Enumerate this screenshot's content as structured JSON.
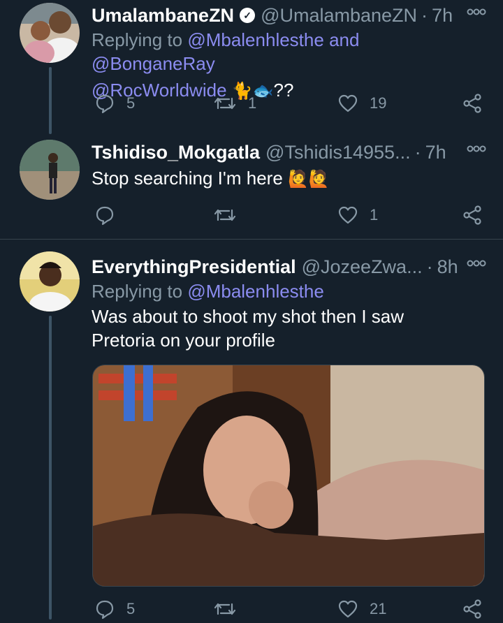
{
  "tweets": [
    {
      "name": "UmalambaneZN",
      "verified_mark": "✓",
      "handle": "@UmalambaneZN",
      "sep": "·",
      "time": "7h",
      "replying_label": "Replying to",
      "mention_1": "@Mbalenhlesthe",
      "mention_join": "and",
      "mention_2": "@BonganeRay",
      "text_mention": "@RocWorldwide",
      "text_emoji_1": "🐈",
      "text_emoji_2": "🐟",
      "text_suffix": "??",
      "reply_count": "5",
      "retweet_count": "1",
      "like_count": "19"
    },
    {
      "name": "Tshidiso_Mokgatla",
      "handle": "@Tshidis14955...",
      "sep": "·",
      "time": "7h",
      "text": "Stop searching I'm here",
      "text_emoji_1": "🙋",
      "text_emoji_2": "🙋",
      "like_count": "1"
    },
    {
      "name": "EverythingPresidential",
      "handle": "@JozeeZwa...",
      "sep": "·",
      "time": "8h",
      "replying_label": "Replying to",
      "mention_1": "@Mbalenhlesthe",
      "text_line_1": "Was about to shoot my shot then I saw",
      "text_line_2": "Pretoria on your profile",
      "reply_count": "5",
      "like_count": "21"
    }
  ],
  "icons": [
    "more-icon",
    "reply-icon",
    "retweet-icon",
    "like-icon",
    "share-icon"
  ],
  "colors": {
    "background": "#15202b",
    "muted": "#8899a6",
    "mention": "#8b8cf0",
    "divider": "#38444d"
  }
}
